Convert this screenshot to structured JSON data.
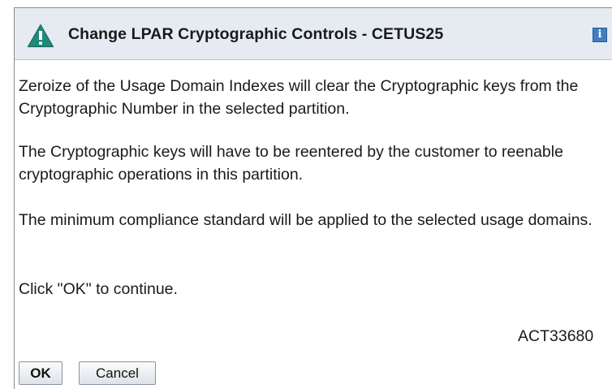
{
  "dialog": {
    "title": "Change LPAR Cryptographic Controls - CETUS25",
    "info_glyph": "i",
    "paragraphs": [
      "Zeroize of the Usage Domain Indexes will clear the Cryptographic keys from the Cryptographic Number in the selected partition.",
      "The Cryptographic keys will have to be reentered by the customer to reenable cryptographic operations in this partition.",
      "The minimum compliance standard will be applied to the selected usage domains.",
      "Click \"OK\" to continue."
    ],
    "message_id": "ACT33680",
    "buttons": {
      "ok_label": "OK",
      "cancel_label": "Cancel"
    }
  },
  "icons": {
    "warning": "warning-triangle-icon",
    "info": "info-icon"
  },
  "colors": {
    "titlebar_bg": "#e6ebf2",
    "warning_fill": "#1f8a7a",
    "info_fill": "#3f7ec4"
  }
}
